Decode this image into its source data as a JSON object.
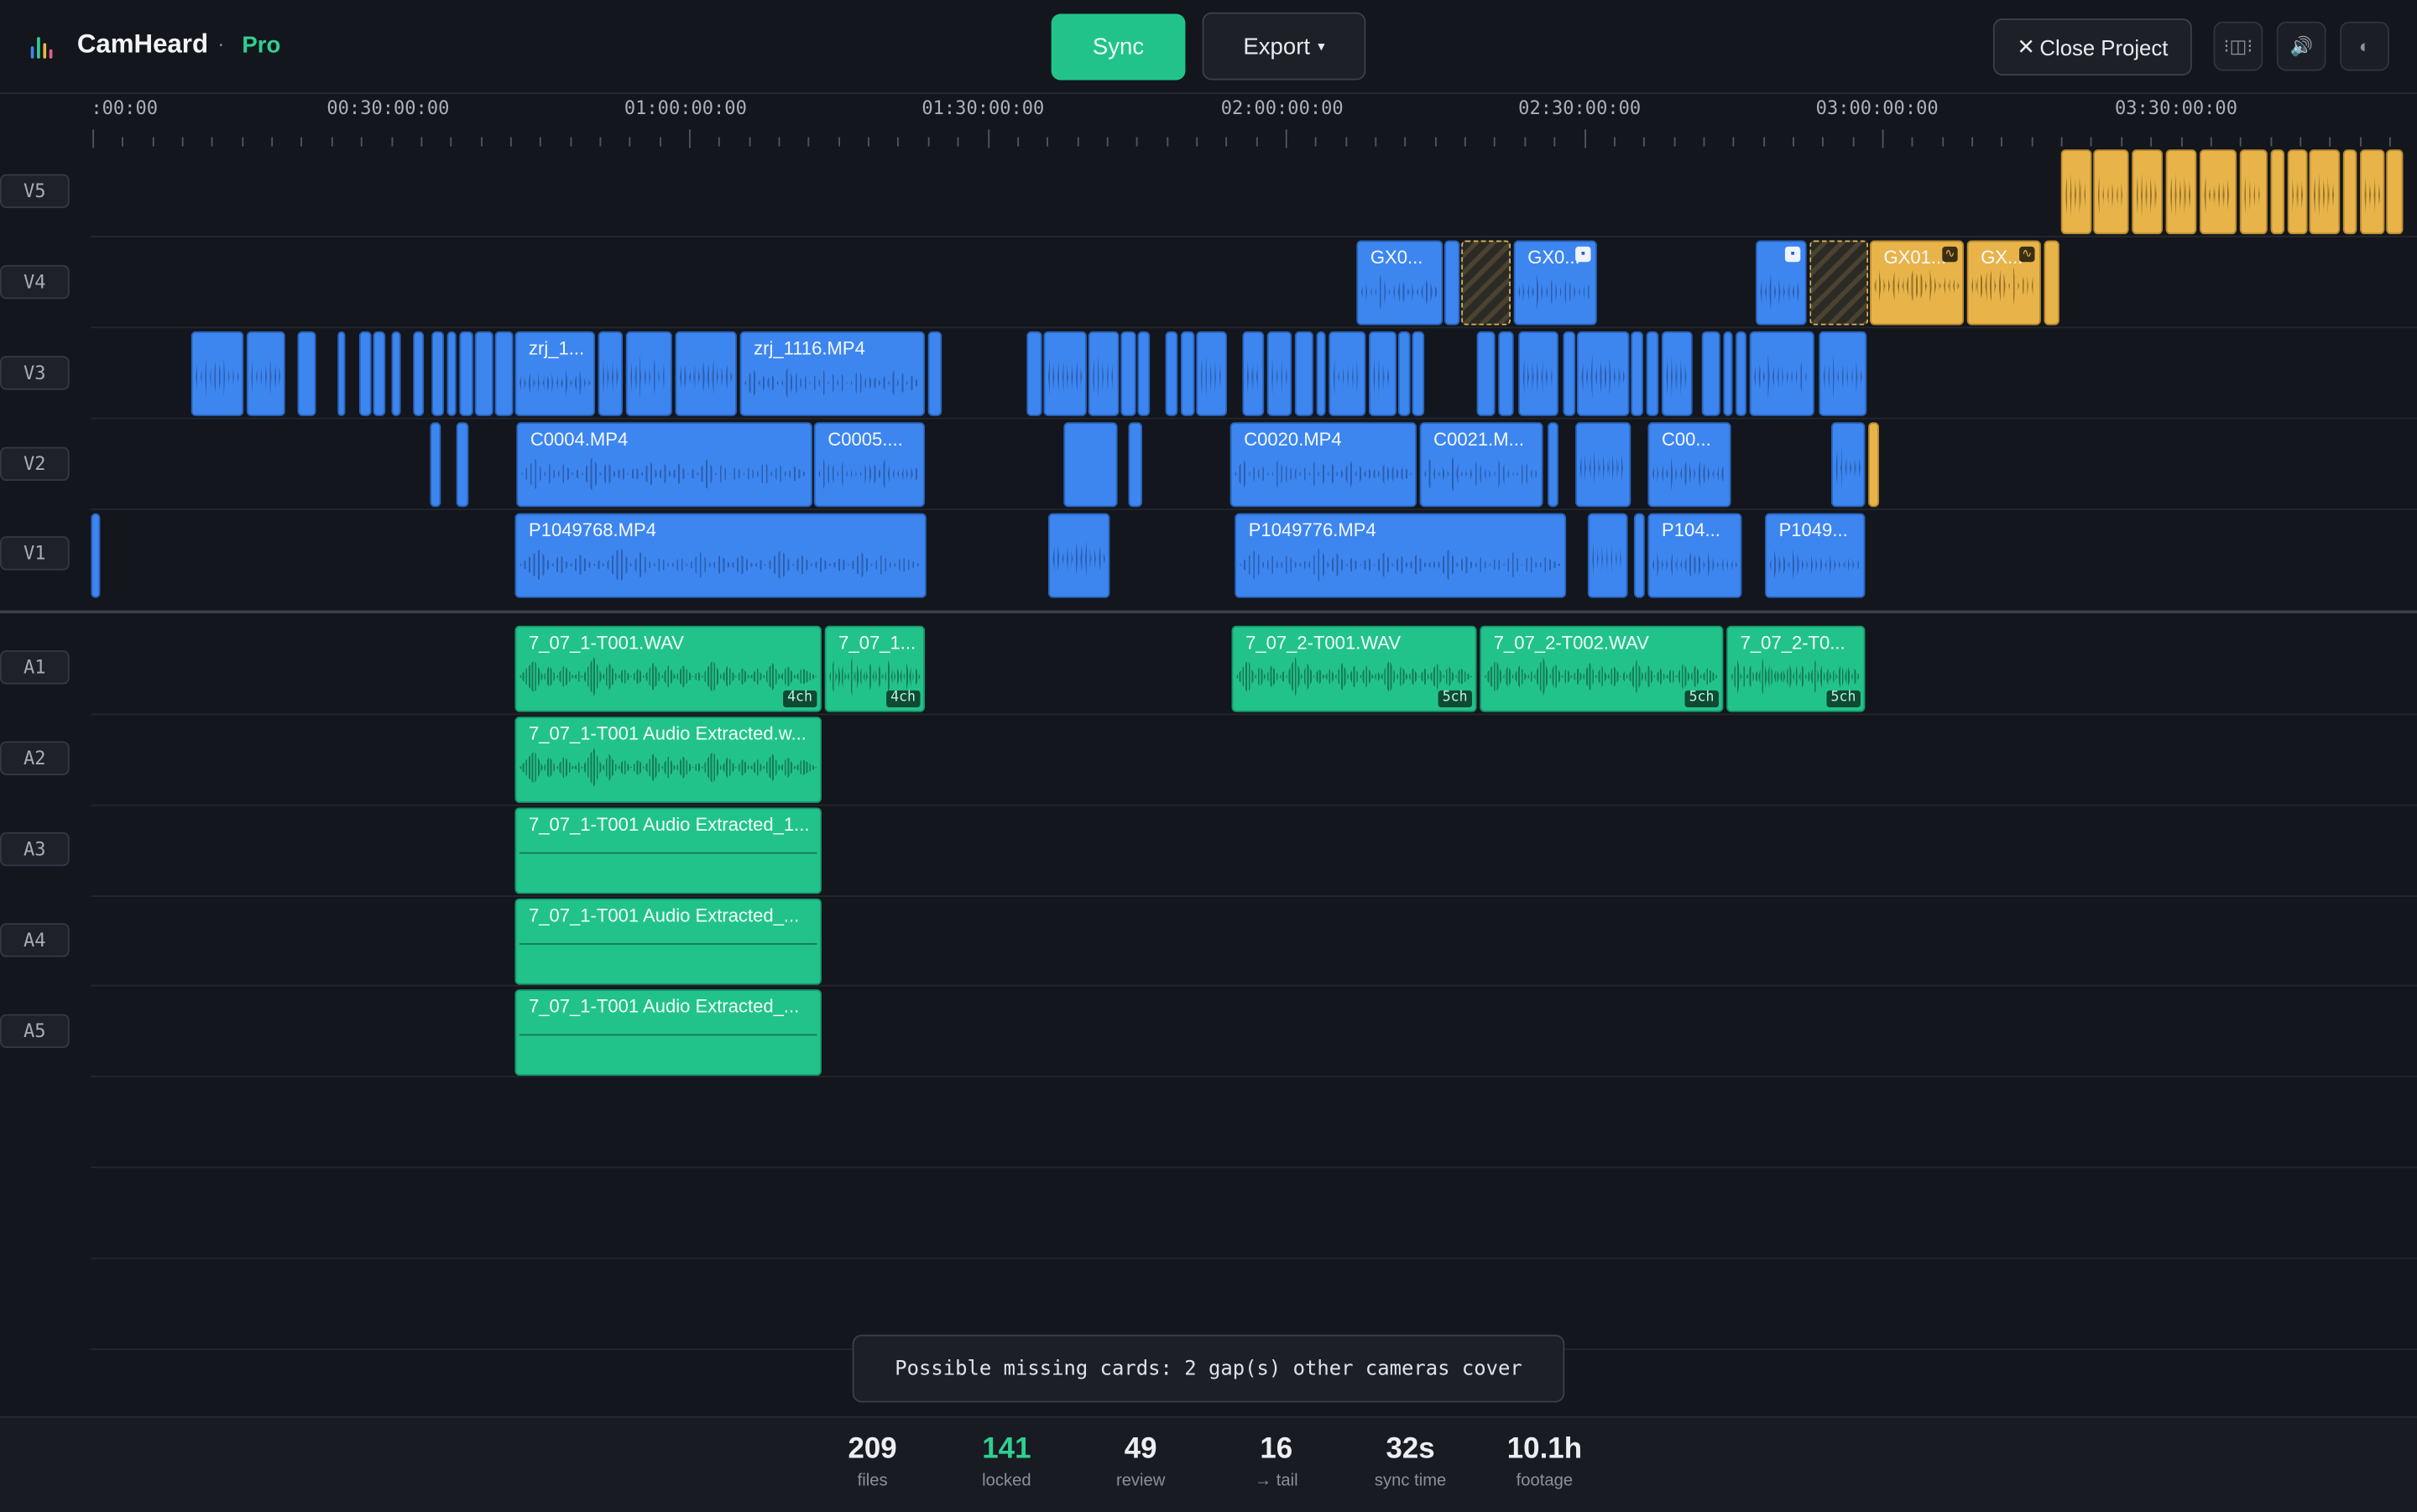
{
  "app": {
    "name": "CamHeard",
    "separator": "·",
    "tier": "Pro"
  },
  "toolbar": {
    "sync_label": "Sync",
    "export_label": "Export",
    "export_caret": "▾",
    "close_label": "Close Project",
    "close_icon": "✕"
  },
  "icon_buttons": [
    {
      "name": "split-icon",
      "glyph": "⁝◫⁝"
    },
    {
      "name": "speaker-icon",
      "glyph": "🔊"
    },
    {
      "name": "contrast-icon",
      "glyph": "◐"
    }
  ],
  "ruler": {
    "labels": [
      ":00:00",
      "00:30:00:00",
      "01:00:00:00",
      "01:30:00:00",
      "02:00:00:00",
      "02:30:00:00",
      "03:00:00:00",
      "03:30:00:00"
    ]
  },
  "video_tracks": [
    "V5",
    "V4",
    "V3",
    "V2",
    "V1"
  ],
  "audio_tracks": [
    "A1",
    "A2",
    "A3",
    "A4",
    "A5"
  ],
  "clips": {
    "v3_a": "zrj_1...",
    "v3_b": "zrj_1116.MP4",
    "v2_a": "C0004.MP4",
    "v2_b": "C0005....",
    "v2_c": "C0020.MP4",
    "v2_d": "C0021.M...",
    "v2_e": "C00...",
    "v1_a": "P1049768.MP4",
    "v1_b": "P1049776.MP4",
    "v1_c": "P104...",
    "v1_d": "P1049...",
    "v4_a": "GX0...",
    "v4_b": "GX0...",
    "v4_c": "GX01...",
    "v4_d": "GX...",
    "a1_a": "7_07_1-T001.WAV",
    "a1_b": "7_07_1...",
    "a1_c": "7_07_2-T001.WAV",
    "a1_d": "7_07_2-T002.WAV",
    "a1_e": "7_07_2-T0...",
    "a2_a": "7_07_1-T001 Audio Extracted.w...",
    "a3_a": "7_07_1-T001 Audio Extracted_1...",
    "a4_a": "7_07_1-T001 Audio Extracted_...",
    "a5_a": "7_07_1-T001 Audio Extracted_..."
  },
  "channel_badges": {
    "a1_a": "4ch",
    "a1_b": "4ch",
    "a1_c": "5ch",
    "a1_d": "5ch",
    "a1_e": "5ch"
  },
  "toast": {
    "message": "Possible missing cards: 2 gap(s) other cameras cover"
  },
  "stats": [
    {
      "value": "209",
      "label": "files"
    },
    {
      "value": "141",
      "label": "locked"
    },
    {
      "value": "49",
      "label": "review"
    },
    {
      "value": "16",
      "label": "→ tail"
    },
    {
      "value": "32s",
      "label": "sync time"
    },
    {
      "value": "10.1h",
      "label": "footage"
    }
  ],
  "colors": {
    "video_clip": "#3d86f0",
    "video_clip_yellow": "#e8b44a",
    "audio_clip": "#22c38a",
    "accent": "#2fcf91",
    "background": "#13161c"
  }
}
